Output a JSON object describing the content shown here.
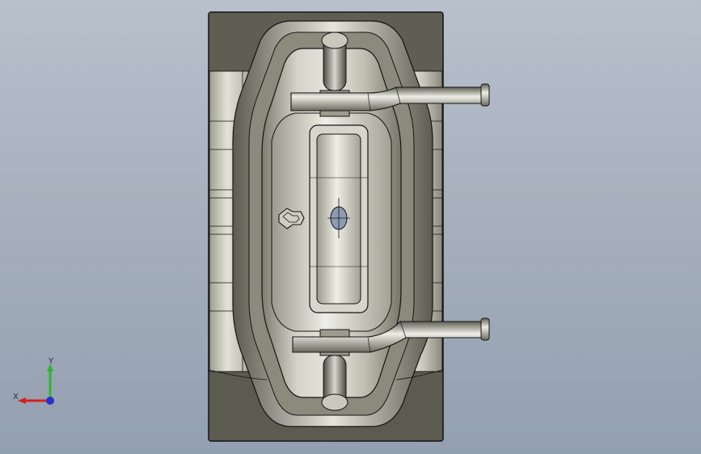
{
  "viewport": {
    "background_top": "#b8c0cb",
    "background_bottom": "#93a0b1"
  },
  "model": {
    "part_color": "#6e6d60",
    "highlight_color": "#d8d7cc",
    "edge_color": "#141414"
  },
  "triad": {
    "x_label": "X",
    "y_label": "Y",
    "x_color": "#d81f1f",
    "y_color": "#2fb52f",
    "z_color": "#2433c9"
  }
}
